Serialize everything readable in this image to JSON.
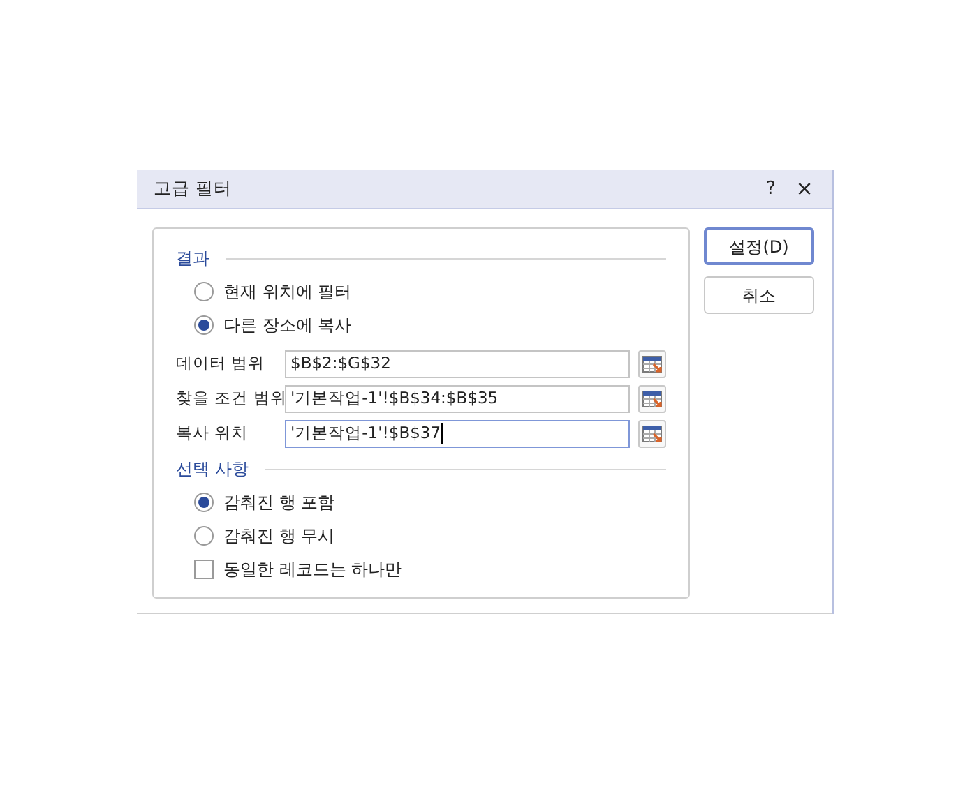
{
  "window": {
    "title": "고급 필터",
    "help": "?",
    "close": "×"
  },
  "result": {
    "title": "결과",
    "options": [
      {
        "label": "현재 위치에 필터",
        "selected": false
      },
      {
        "label": "다른 장소에 복사",
        "selected": true
      }
    ]
  },
  "fields": [
    {
      "label": "데이터 범위",
      "value": "$B$2:$G$32",
      "focused": false
    },
    {
      "label": "찾을 조건 범위",
      "value": "'기본작업-1'!$B$34:$B$35",
      "focused": false
    },
    {
      "label": "복사 위치",
      "value": "'기본작업-1'!$B$37",
      "focused": true
    }
  ],
  "options": {
    "title": "선택 사항",
    "items": [
      {
        "kind": "radio",
        "label": "감춰진 행 포함",
        "selected": true
      },
      {
        "kind": "radio",
        "label": "감춰진 행 무시",
        "selected": false
      },
      {
        "kind": "checkbox",
        "label": "동일한 레코드는 하나만",
        "checked": false
      }
    ]
  },
  "buttons": [
    {
      "label": "설정(D)",
      "default": true
    },
    {
      "label": "취소",
      "default": false
    }
  ]
}
